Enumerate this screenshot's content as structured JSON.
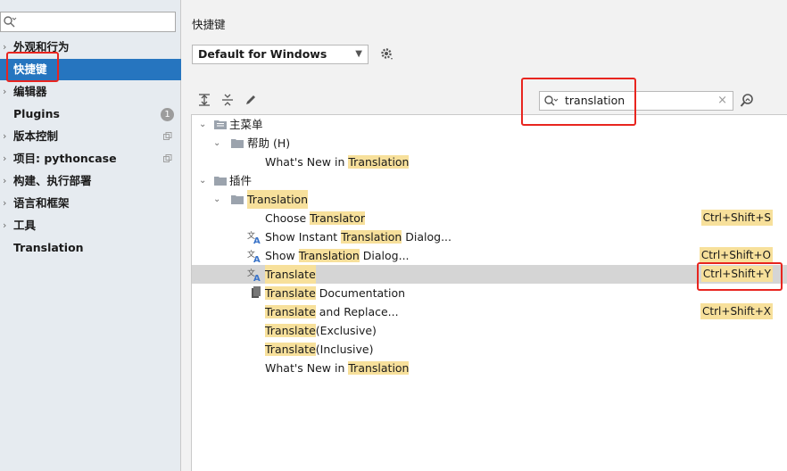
{
  "sidebar": {
    "search_placeholder": "",
    "items": [
      {
        "label": "外观和行为",
        "chevron": "›"
      },
      {
        "label": "快捷键",
        "chevron": ""
      },
      {
        "label": "编辑器",
        "chevron": "›"
      },
      {
        "label": "Plugins",
        "chevron": "",
        "badge": "1"
      },
      {
        "label": "版本控制",
        "chevron": "›"
      },
      {
        "label": "项目: pythoncase",
        "chevron": "›"
      },
      {
        "label": "构建、执行部署",
        "chevron": "›"
      },
      {
        "label": "语言和框架",
        "chevron": "›"
      },
      {
        "label": "工具",
        "chevron": "›"
      },
      {
        "label": "Translation",
        "chevron": ""
      }
    ]
  },
  "main": {
    "title": "快捷键",
    "keymap": "Default for Windows",
    "search_value": "translation",
    "clear_glyph": "×"
  },
  "tree": {
    "main_menu": "主菜单",
    "help": "帮助 (H)",
    "whats_new_prefix": "What's New in ",
    "translation": "Translation",
    "plugins": "插件",
    "choose_prefix": "Choose ",
    "translator": "Translator",
    "show_instant_prefix": "Show Instant ",
    "dialog_suffix": " Dialog...",
    "show_prefix": "Show ",
    "translate": "Translate",
    "documentation_suffix": " Documentation",
    "and_replace_suffix": " and Replace...",
    "exclusive_suffix": "(Exclusive)",
    "inclusive_suffix": "(Inclusive)",
    "shortcuts": {
      "choose": "Ctrl+Shift+S",
      "show_dialog": "Ctrl+Shift+O",
      "translate": "Ctrl+Shift+Y",
      "replace": "Ctrl+Shift+X"
    }
  },
  "colors": {
    "selection": "#2675bf",
    "highlight": "#f7e09b",
    "annotation": "#e8251f"
  }
}
